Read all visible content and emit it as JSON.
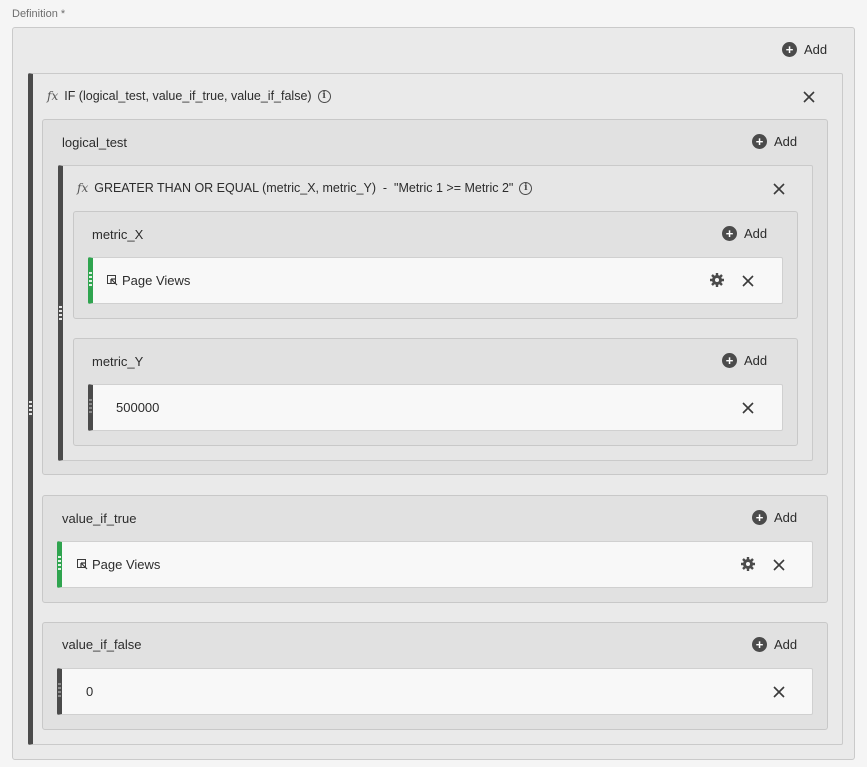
{
  "definition_label": "Definition *",
  "add_label": "Add",
  "if_func": {
    "title": "IF (logical_test, value_if_true, value_if_false)",
    "fx": "fx"
  },
  "logical_test": {
    "label": "logical_test",
    "func": {
      "fx": "fx",
      "title": "GREATER THAN OR EQUAL (metric_X, metric_Y)  -  \"Metric 1 >= Metric 2\""
    },
    "metric_x": {
      "label": "metric_X",
      "item": "Page Views"
    },
    "metric_y": {
      "label": "metric_Y",
      "item": "500000"
    }
  },
  "value_if_true": {
    "label": "value_if_true",
    "item": "Page Views"
  },
  "value_if_false": {
    "label": "value_if_false",
    "item": "0"
  },
  "colors": {
    "metric_accent": "#2fa44f",
    "static_accent": "#4b4b4b"
  }
}
